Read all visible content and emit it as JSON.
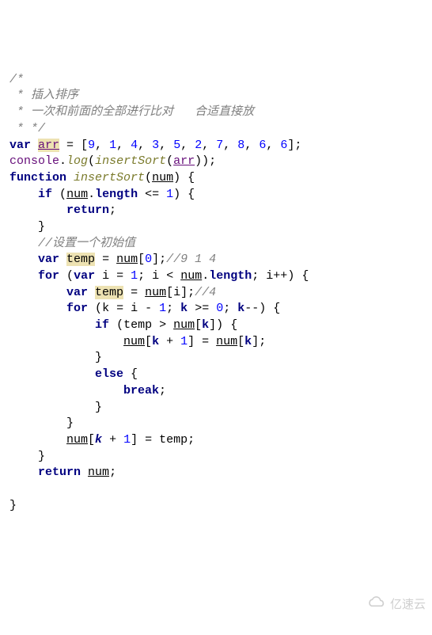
{
  "code": {
    "c1": "/*",
    "c2": " * 插入排序",
    "c3": " * 一次和前面的全部进行比对   合适直接放",
    "c4": " * */",
    "kw_var": "var",
    "arr": "arr",
    "eq": " = ",
    "lb": "[",
    "rb": "]",
    "n9": "9",
    "n1": "1",
    "n4": "4",
    "n3": "3",
    "n5": "5",
    "n2": "2",
    "n7": "7",
    "n8": "8",
    "n6a": "6",
    "n6b": "6",
    "sep": ", ",
    "semi": ";",
    "console": "console",
    "dot": ".",
    "log": "log",
    "lp": "(",
    "rp": ")",
    "insertSort": "insertSort",
    "kw_function": "function",
    "num": "num",
    "ob": " {",
    "cb": "}",
    "kw_if": "if",
    "length": "length",
    "le1": " <= ",
    "kw_return": "return",
    "c_init": "//设置一个初始值",
    "temp": "temp",
    "idx0": "0",
    "c914": "//9 1 4",
    "kw_for": "for",
    "i": "i",
    "assign1": " = ",
    "lt": " < ",
    "ipp": "++",
    "c4only": "//4",
    "k": "k",
    "minus1": " - ",
    "ge0": " >= ",
    "kmm": "--",
    "gt": " > ",
    "kplus1": " + ",
    "kw_else": "else",
    "kw_break": "break"
  },
  "watermark": "亿速云"
}
